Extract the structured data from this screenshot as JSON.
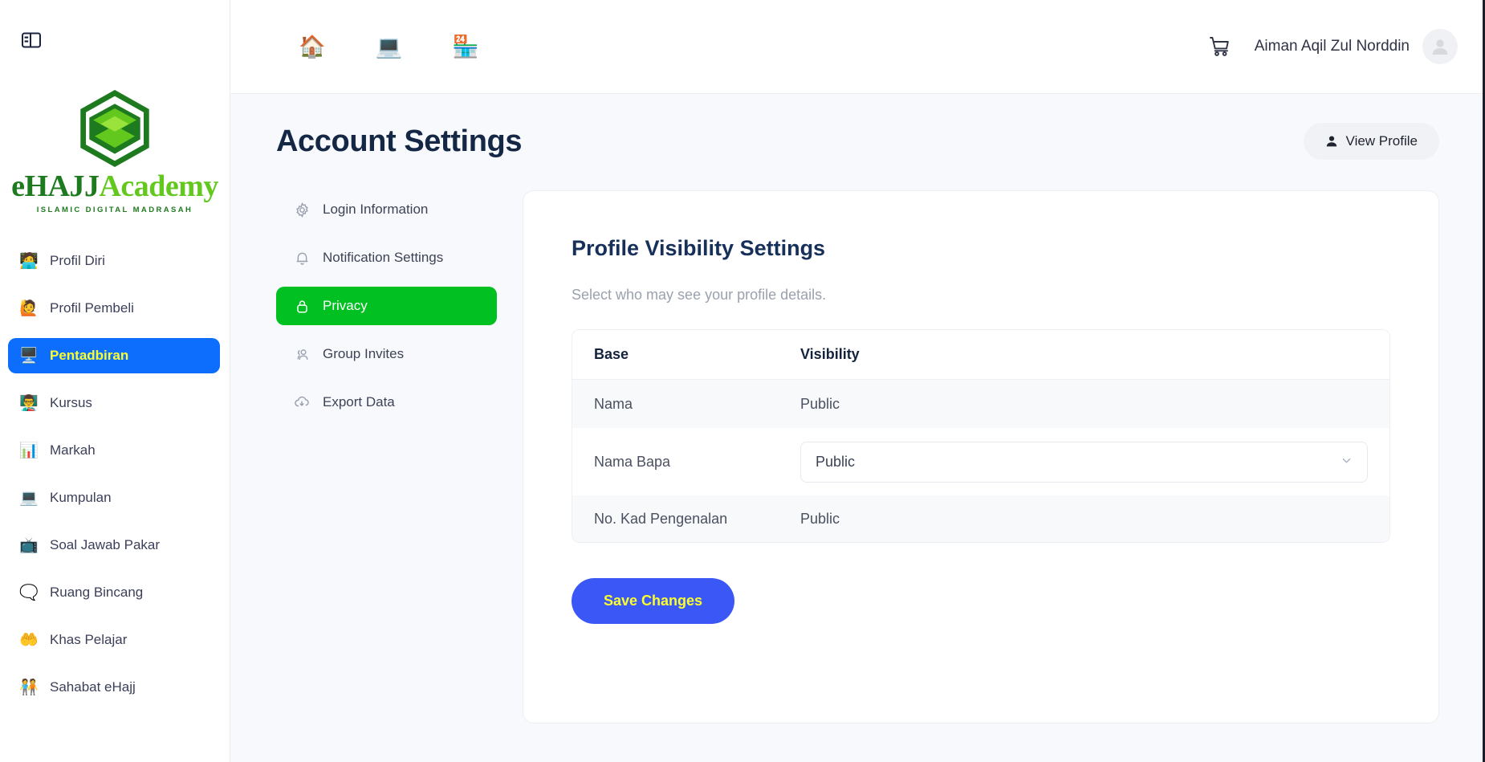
{
  "sidebar": {
    "toggle_icon": "panel-toggle-icon",
    "brand": {
      "logo_icon": "kaaba-cube-logo",
      "name_part1": "eHAJJ",
      "name_part2": "Academy",
      "tagline": "ISLAMIC DIGITAL MADRASAH"
    },
    "items": [
      {
        "label": "Profil Diri",
        "emoji": "🧑‍💻",
        "icon": "user-profile-icon",
        "active": false
      },
      {
        "label": "Profil Pembeli",
        "emoji": "🙋",
        "icon": "buyer-profile-icon",
        "active": false
      },
      {
        "label": "Pentadbiran",
        "emoji": "🖥️",
        "icon": "admin-icon",
        "active": true
      },
      {
        "label": "Kursus",
        "emoji": "👨‍🏫",
        "icon": "course-icon",
        "active": false
      },
      {
        "label": "Markah",
        "emoji": "📊",
        "icon": "score-chart-icon",
        "active": false
      },
      {
        "label": "Kumpulan",
        "emoji": "💻",
        "icon": "group-icon",
        "active": false
      },
      {
        "label": "Soal Jawab Pakar",
        "emoji": "📺",
        "icon": "expert-qa-icon",
        "active": false
      },
      {
        "label": "Ruang Bincang",
        "emoji": "🗨️",
        "icon": "discussion-icon",
        "active": false
      },
      {
        "label": "Khas Pelajar",
        "emoji": "🤲",
        "icon": "student-special-icon",
        "active": false
      },
      {
        "label": "Sahabat eHajj",
        "emoji": "🧑‍🤝‍🧑",
        "icon": "friends-icon",
        "active": false
      }
    ]
  },
  "topbar": {
    "icons": [
      {
        "emoji": "🏠",
        "name": "home-icon"
      },
      {
        "emoji": "💻",
        "name": "elearning-icon"
      },
      {
        "emoji": "🏪",
        "name": "store-icon"
      }
    ],
    "cart_icon": "shopping-cart-icon",
    "user_name": "Aiman Aqil Zul Norddin",
    "avatar_icon": "user-avatar-icon"
  },
  "page": {
    "title": "Account Settings",
    "view_profile_label": "View Profile",
    "view_profile_icon": "person-icon"
  },
  "settings_tabs": [
    {
      "label": "Login Information",
      "icon": "gear-icon",
      "active": false
    },
    {
      "label": "Notification Settings",
      "icon": "bell-icon",
      "active": false
    },
    {
      "label": "Privacy",
      "icon": "lock-icon",
      "active": true
    },
    {
      "label": "Group Invites",
      "icon": "people-icon",
      "active": false
    },
    {
      "label": "Export Data",
      "icon": "cloud-download-icon",
      "active": false
    }
  ],
  "panel": {
    "title": "Profile Visibility Settings",
    "subtitle": "Select who may see your profile details.",
    "table": {
      "columns": [
        "Base",
        "Visibility"
      ],
      "rows": [
        {
          "base": "Nama",
          "visibility": "Public",
          "editable": false
        },
        {
          "base": "Nama Bapa",
          "visibility": "Public",
          "editable": true
        },
        {
          "base": "No. Kad Pengenalan",
          "visibility": "Public",
          "editable": false
        }
      ],
      "dropdown_icon": "chevron-down-icon"
    },
    "save_label": "Save Changes"
  },
  "colors": {
    "sidebar_active_bg": "#0d6efd",
    "sidebar_active_text": "#fbff2e",
    "tab_active_bg": "#00c121",
    "save_button_bg": "#3b57f5",
    "save_button_text": "#fbff2e",
    "brand_dark_green": "#1e7a1e",
    "brand_light_green": "#63c81e",
    "page_bg": "#f8f9fc"
  }
}
